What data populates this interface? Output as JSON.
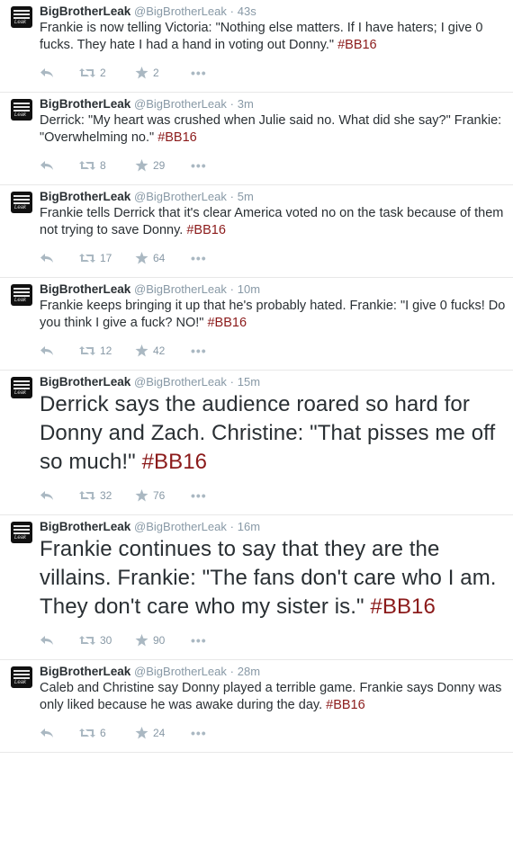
{
  "colors": {
    "hashtag": "#8b1a1a",
    "meta": "#8899a6",
    "icon": "#aab8c2"
  },
  "tweets": [
    {
      "name": "BigBrotherLeak",
      "handle": "@BigBrotherLeak",
      "time": "43s",
      "text": "Frankie is now telling Victoria: \"Nothing else matters. If I have haters; I give 0 fucks. They hate I had a hand in voting out Donny.\" ",
      "hashtag": "#BB16",
      "retweets": "2",
      "favorites": "2",
      "large": false
    },
    {
      "name": "BigBrotherLeak",
      "handle": "@BigBrotherLeak",
      "time": "3m",
      "text": "Derrick: \"My heart was crushed when Julie said no. What did she say?\" Frankie: \"Overwhelming no.\" ",
      "hashtag": "#BB16",
      "retweets": "8",
      "favorites": "29",
      "large": false
    },
    {
      "name": "BigBrotherLeak",
      "handle": "@BigBrotherLeak",
      "time": "5m",
      "text": "Frankie tells Derrick that it's clear America voted no on the task because of them not trying to save Donny. ",
      "hashtag": "#BB16",
      "retweets": "17",
      "favorites": "64",
      "large": false
    },
    {
      "name": "BigBrotherLeak",
      "handle": "@BigBrotherLeak",
      "time": "10m",
      "text": "Frankie keeps bringing it up that he's probably hated. Frankie: \"I give 0 fucks! Do you think I give a fuck? NO!\" ",
      "hashtag": "#BB16",
      "retweets": "12",
      "favorites": "42",
      "large": false
    },
    {
      "name": "BigBrotherLeak",
      "handle": "@BigBrotherLeak",
      "time": "15m",
      "text": "Derrick says the audience roared so hard for Donny and Zach. Christine: \"That pisses me off so much!\" ",
      "hashtag": "#BB16",
      "retweets": "32",
      "favorites": "76",
      "large": true
    },
    {
      "name": "BigBrotherLeak",
      "handle": "@BigBrotherLeak",
      "time": "16m",
      "text": "Frankie continues to say that they are the villains. Frankie: \"The fans don't care who I am. They don't care who my sister is.\" ",
      "hashtag": "#BB16",
      "retweets": "30",
      "favorites": "90",
      "large": true
    },
    {
      "name": "BigBrotherLeak",
      "handle": "@BigBrotherLeak",
      "time": "28m",
      "text": "Caleb and Christine say Donny played a terrible game. Frankie says Donny was only liked because he was awake during the day. ",
      "hashtag": "#BB16",
      "retweets": "6",
      "favorites": "24",
      "large": false
    }
  ],
  "separator": "·",
  "more_icon": "•••",
  "avatar_script": "Leak"
}
